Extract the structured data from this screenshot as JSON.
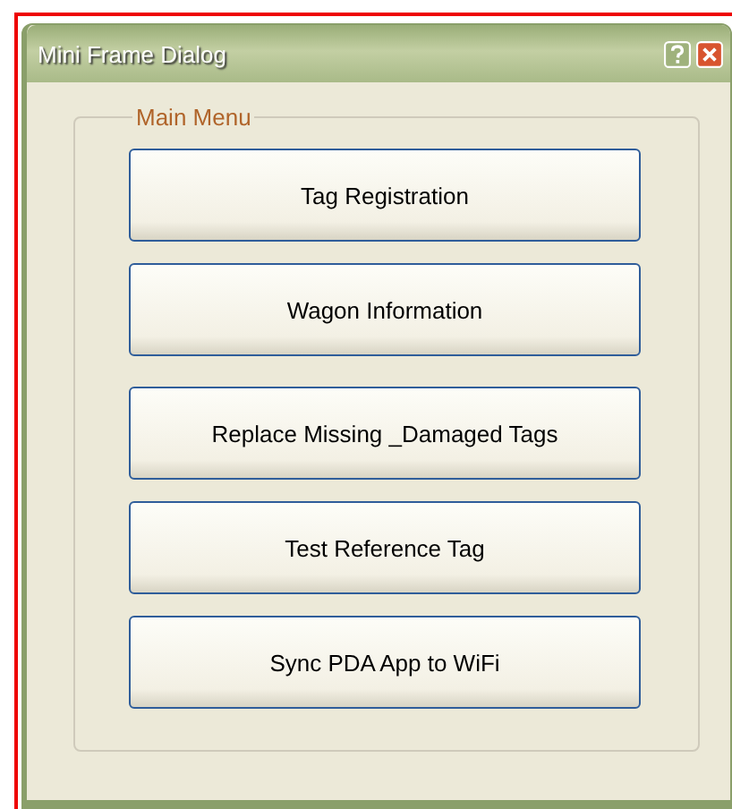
{
  "window": {
    "title": "Mini Frame Dialog"
  },
  "group": {
    "title": "Main Menu"
  },
  "buttons": [
    {
      "label": "Tag Registration"
    },
    {
      "label": "Wagon Information"
    },
    {
      "label": "Replace Missing _Damaged Tags"
    },
    {
      "label": "Test Reference Tag"
    },
    {
      "label": "Sync PDA App to WiFi"
    }
  ]
}
